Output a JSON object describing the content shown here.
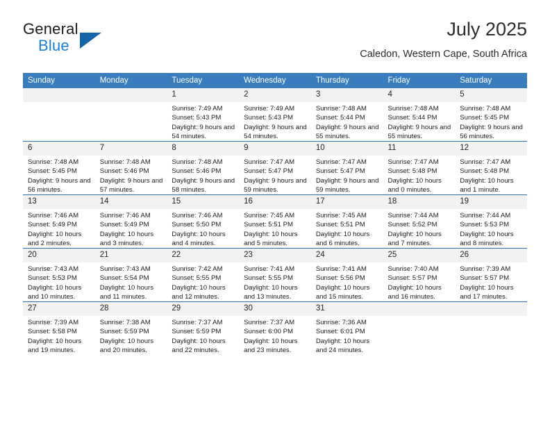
{
  "brand": {
    "name_part1": "General",
    "name_part2": "Blue",
    "logo_icon": "triangle-flag-icon",
    "color_dark": "#1a1a1a",
    "color_blue": "#1c7ed6",
    "color_triangle": "#1565a8"
  },
  "header": {
    "month_title": "July 2025",
    "location": "Caledon, Western Cape, South Africa"
  },
  "theme": {
    "header_row_bg": "#3a7dbf",
    "header_row_text": "#ffffff",
    "row_divider": "#2f6fab",
    "daynum_bg": "#f2f2f2"
  },
  "weekdays": [
    "Sunday",
    "Monday",
    "Tuesday",
    "Wednesday",
    "Thursday",
    "Friday",
    "Saturday"
  ],
  "weeks": [
    [
      {
        "empty": true
      },
      {
        "empty": true
      },
      {
        "day": "1",
        "sunrise": "Sunrise: 7:49 AM",
        "sunset": "Sunset: 5:43 PM",
        "daylight": "Daylight: 9 hours and 54 minutes."
      },
      {
        "day": "2",
        "sunrise": "Sunrise: 7:49 AM",
        "sunset": "Sunset: 5:43 PM",
        "daylight": "Daylight: 9 hours and 54 minutes."
      },
      {
        "day": "3",
        "sunrise": "Sunrise: 7:48 AM",
        "sunset": "Sunset: 5:44 PM",
        "daylight": "Daylight: 9 hours and 55 minutes."
      },
      {
        "day": "4",
        "sunrise": "Sunrise: 7:48 AM",
        "sunset": "Sunset: 5:44 PM",
        "daylight": "Daylight: 9 hours and 55 minutes."
      },
      {
        "day": "5",
        "sunrise": "Sunrise: 7:48 AM",
        "sunset": "Sunset: 5:45 PM",
        "daylight": "Daylight: 9 hours and 56 minutes."
      }
    ],
    [
      {
        "day": "6",
        "sunrise": "Sunrise: 7:48 AM",
        "sunset": "Sunset: 5:45 PM",
        "daylight": "Daylight: 9 hours and 56 minutes."
      },
      {
        "day": "7",
        "sunrise": "Sunrise: 7:48 AM",
        "sunset": "Sunset: 5:46 PM",
        "daylight": "Daylight: 9 hours and 57 minutes."
      },
      {
        "day": "8",
        "sunrise": "Sunrise: 7:48 AM",
        "sunset": "Sunset: 5:46 PM",
        "daylight": "Daylight: 9 hours and 58 minutes."
      },
      {
        "day": "9",
        "sunrise": "Sunrise: 7:47 AM",
        "sunset": "Sunset: 5:47 PM",
        "daylight": "Daylight: 9 hours and 59 minutes."
      },
      {
        "day": "10",
        "sunrise": "Sunrise: 7:47 AM",
        "sunset": "Sunset: 5:47 PM",
        "daylight": "Daylight: 9 hours and 59 minutes."
      },
      {
        "day": "11",
        "sunrise": "Sunrise: 7:47 AM",
        "sunset": "Sunset: 5:48 PM",
        "daylight": "Daylight: 10 hours and 0 minutes."
      },
      {
        "day": "12",
        "sunrise": "Sunrise: 7:47 AM",
        "sunset": "Sunset: 5:48 PM",
        "daylight": "Daylight: 10 hours and 1 minute."
      }
    ],
    [
      {
        "day": "13",
        "sunrise": "Sunrise: 7:46 AM",
        "sunset": "Sunset: 5:49 PM",
        "daylight": "Daylight: 10 hours and 2 minutes."
      },
      {
        "day": "14",
        "sunrise": "Sunrise: 7:46 AM",
        "sunset": "Sunset: 5:49 PM",
        "daylight": "Daylight: 10 hours and 3 minutes."
      },
      {
        "day": "15",
        "sunrise": "Sunrise: 7:46 AM",
        "sunset": "Sunset: 5:50 PM",
        "daylight": "Daylight: 10 hours and 4 minutes."
      },
      {
        "day": "16",
        "sunrise": "Sunrise: 7:45 AM",
        "sunset": "Sunset: 5:51 PM",
        "daylight": "Daylight: 10 hours and 5 minutes."
      },
      {
        "day": "17",
        "sunrise": "Sunrise: 7:45 AM",
        "sunset": "Sunset: 5:51 PM",
        "daylight": "Daylight: 10 hours and 6 minutes."
      },
      {
        "day": "18",
        "sunrise": "Sunrise: 7:44 AM",
        "sunset": "Sunset: 5:52 PM",
        "daylight": "Daylight: 10 hours and 7 minutes."
      },
      {
        "day": "19",
        "sunrise": "Sunrise: 7:44 AM",
        "sunset": "Sunset: 5:53 PM",
        "daylight": "Daylight: 10 hours and 8 minutes."
      }
    ],
    [
      {
        "day": "20",
        "sunrise": "Sunrise: 7:43 AM",
        "sunset": "Sunset: 5:53 PM",
        "daylight": "Daylight: 10 hours and 10 minutes."
      },
      {
        "day": "21",
        "sunrise": "Sunrise: 7:43 AM",
        "sunset": "Sunset: 5:54 PM",
        "daylight": "Daylight: 10 hours and 11 minutes."
      },
      {
        "day": "22",
        "sunrise": "Sunrise: 7:42 AM",
        "sunset": "Sunset: 5:55 PM",
        "daylight": "Daylight: 10 hours and 12 minutes."
      },
      {
        "day": "23",
        "sunrise": "Sunrise: 7:41 AM",
        "sunset": "Sunset: 5:55 PM",
        "daylight": "Daylight: 10 hours and 13 minutes."
      },
      {
        "day": "24",
        "sunrise": "Sunrise: 7:41 AM",
        "sunset": "Sunset: 5:56 PM",
        "daylight": "Daylight: 10 hours and 15 minutes."
      },
      {
        "day": "25",
        "sunrise": "Sunrise: 7:40 AM",
        "sunset": "Sunset: 5:57 PM",
        "daylight": "Daylight: 10 hours and 16 minutes."
      },
      {
        "day": "26",
        "sunrise": "Sunrise: 7:39 AM",
        "sunset": "Sunset: 5:57 PM",
        "daylight": "Daylight: 10 hours and 17 minutes."
      }
    ],
    [
      {
        "day": "27",
        "sunrise": "Sunrise: 7:39 AM",
        "sunset": "Sunset: 5:58 PM",
        "daylight": "Daylight: 10 hours and 19 minutes."
      },
      {
        "day": "28",
        "sunrise": "Sunrise: 7:38 AM",
        "sunset": "Sunset: 5:59 PM",
        "daylight": "Daylight: 10 hours and 20 minutes."
      },
      {
        "day": "29",
        "sunrise": "Sunrise: 7:37 AM",
        "sunset": "Sunset: 5:59 PM",
        "daylight": "Daylight: 10 hours and 22 minutes."
      },
      {
        "day": "30",
        "sunrise": "Sunrise: 7:37 AM",
        "sunset": "Sunset: 6:00 PM",
        "daylight": "Daylight: 10 hours and 23 minutes."
      },
      {
        "day": "31",
        "sunrise": "Sunrise: 7:36 AM",
        "sunset": "Sunset: 6:01 PM",
        "daylight": "Daylight: 10 hours and 24 minutes."
      },
      {
        "empty": true
      },
      {
        "empty": true
      }
    ]
  ]
}
